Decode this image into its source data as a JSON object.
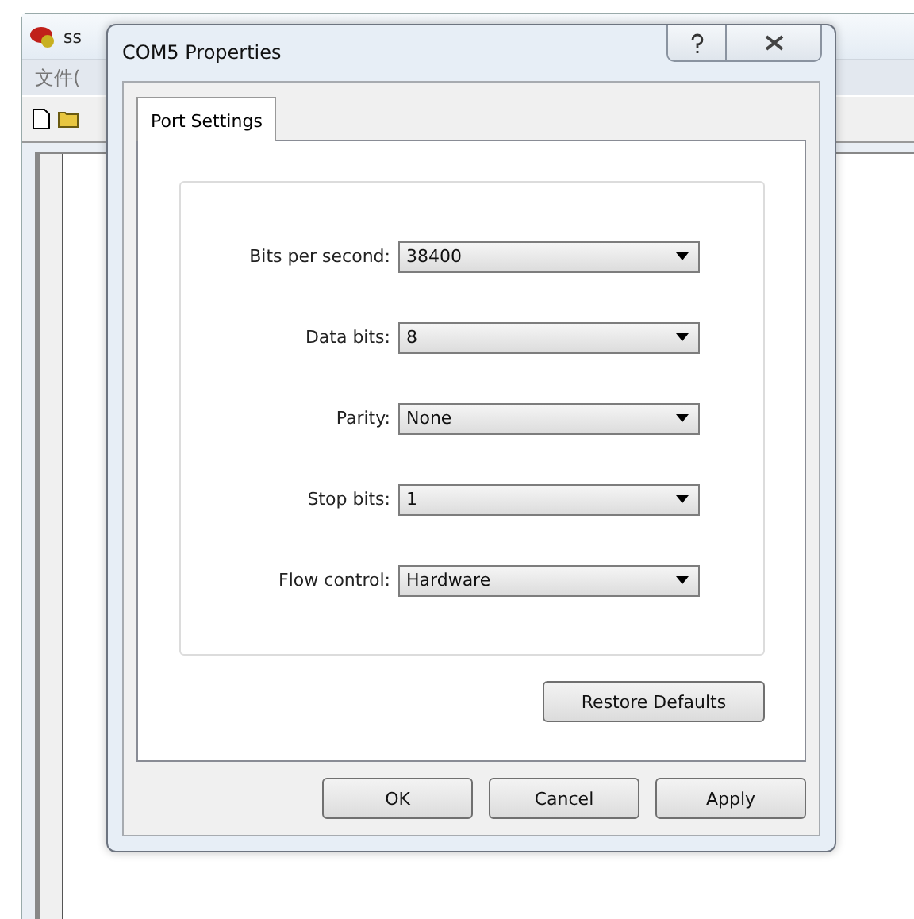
{
  "background_window": {
    "title": "ss",
    "menu": [
      "文件("
    ]
  },
  "dialog": {
    "title": "COM5 Properties",
    "tabs": [
      {
        "label": "Port Settings",
        "selected": true
      }
    ],
    "settings": [
      {
        "label": "Bits per second:",
        "value": "38400"
      },
      {
        "label": "Data bits:",
        "value": "8"
      },
      {
        "label": "Parity:",
        "value": "None"
      },
      {
        "label": "Stop bits:",
        "value": "1"
      },
      {
        "label": "Flow control:",
        "value": "Hardware"
      }
    ],
    "restore_button": "Restore Defaults",
    "buttons": [
      "OK",
      "Cancel",
      "Apply"
    ]
  }
}
